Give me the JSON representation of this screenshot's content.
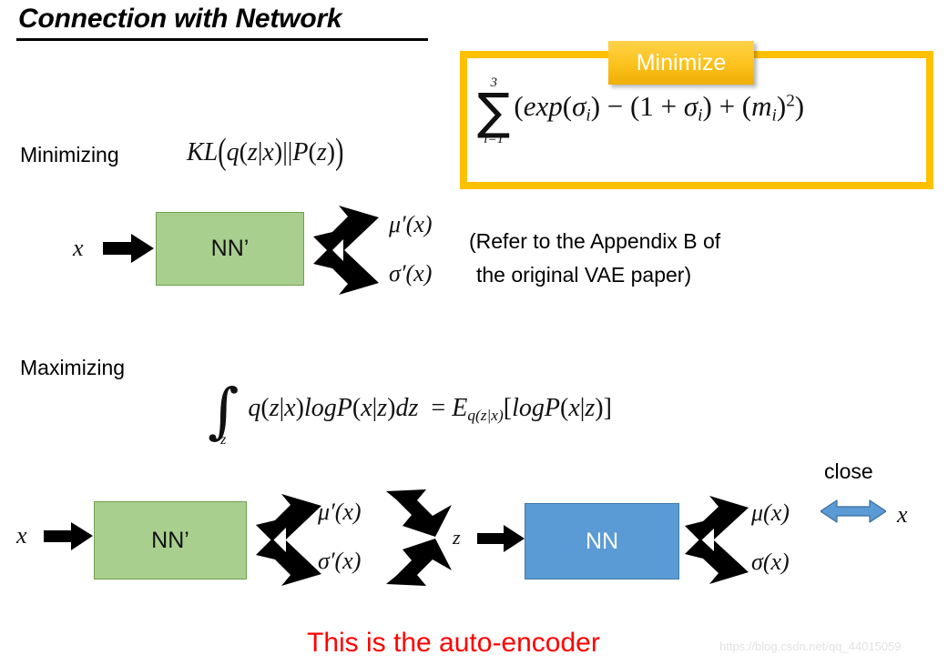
{
  "slide": {
    "title": "Connection with Network",
    "background": "#ffffff"
  },
  "colors": {
    "yellow_border": "#FFC000",
    "badge_gradient_top": "#FFD24A",
    "badge_gradient_bottom": "#EEAE06",
    "nn_green_fill": "#A9CF8F",
    "nn_green_border": "#6F9E52",
    "nn_blue_fill": "#5B9BD5",
    "nn_blue_border": "#41799F",
    "caption_red": "#FF0000",
    "arrow_black": "#000000",
    "close_arrow_blue": "#5B9BD5"
  },
  "callout": {
    "badge_label": "Minimize",
    "formula": {
      "sum_upper": "3",
      "sum_lower": "i=1",
      "body": "(exp(σi) − (1 + σi) + (mi)2)",
      "body_parts": {
        "open": "(",
        "exp": "exp",
        "sigma": "σ",
        "sigma_sub": "i",
        "minus": "−",
        "one": "1",
        "plus": "+",
        "m": "m",
        "m_sub": "i",
        "power": "2",
        "close": ")"
      }
    }
  },
  "minimizing_row": {
    "label": "Minimizing",
    "formula": {
      "kl": "KL",
      "q": "q",
      "z": "z",
      "bar": "|",
      "x": "x",
      "dbar": "||",
      "P": "P"
    }
  },
  "maximizing_row": {
    "label": "Maximizing",
    "formula": {
      "integral_glyph": "∫",
      "integral_lower": "z",
      "q": "q",
      "z": "z",
      "x": "x",
      "log": "log",
      "P": "P",
      "dz": "dz",
      "equals": "=",
      "E": "E",
      "E_sub": "q(z|x)",
      "bracket_open": "[",
      "bracket_close": "]"
    }
  },
  "diagram_top": {
    "input_label": "x",
    "box_label": "NN’",
    "output_mu": "μ′(x)",
    "output_sigma": "σ′(x)",
    "note_line1": "(Refer to the Appendix B of",
    "note_line2": "the original VAE paper)"
  },
  "diagram_bottom": {
    "input_label": "x",
    "encoder_box_label": "NN’",
    "encoder_mu": "μ′(x)",
    "encoder_sigma": "σ′(x)",
    "latent_label": "z",
    "decoder_box_label": "NN",
    "decoder_mu": "μ(x)",
    "decoder_sigma": "σ(x)",
    "close_label": "close",
    "target_label": "x"
  },
  "footer": {
    "caption": "This is the auto-encoder",
    "watermark": "https://blog.csdn.net/qq_44015059"
  }
}
